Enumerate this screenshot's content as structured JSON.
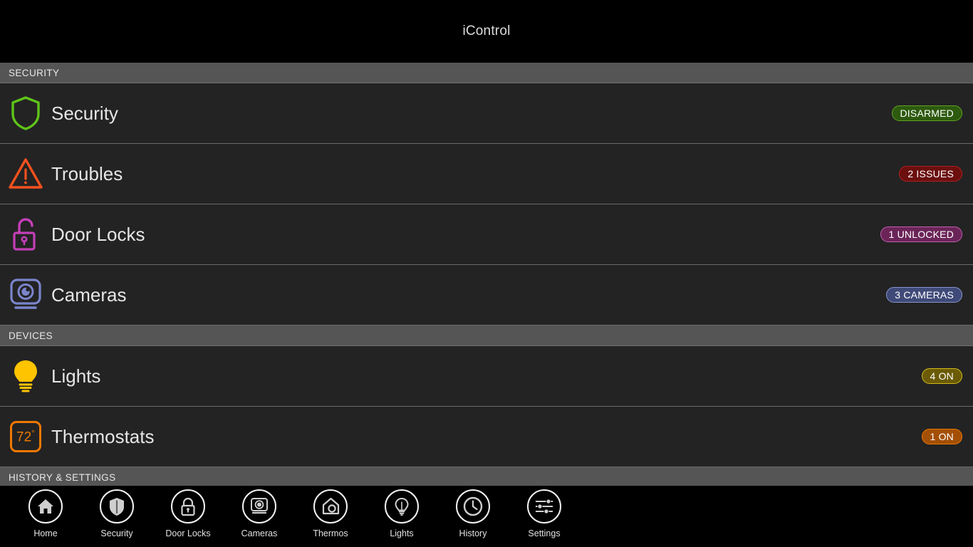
{
  "app": {
    "title": "iControl",
    "background": "#000000",
    "row_background": "#232323",
    "section_header_background": "#555555"
  },
  "sections": [
    {
      "id": "security",
      "header": "SECURITY",
      "rows": [
        {
          "id": "security",
          "label": "Security",
          "icon": "shield-icon",
          "icon_color": "#5fc419",
          "badge": {
            "text": "DISARMED",
            "fill": "#2d5a0f",
            "border": "#5fa320",
            "text_color": "#ffffff"
          }
        },
        {
          "id": "troubles",
          "label": "Troubles",
          "icon": "warning-triangle-icon",
          "icon_color": "#f4511e",
          "badge": {
            "text": "2 ISSUES",
            "fill": "#6b0f0f",
            "border": "#b32020",
            "text_color": "#ffffff"
          }
        },
        {
          "id": "door-locks",
          "label": "Door Locks",
          "icon": "unlocked-padlock-icon",
          "icon_color": "#c43fb8",
          "badge": {
            "text": "1 UNLOCKED",
            "fill": "#6b2458",
            "border": "#c060b0",
            "text_color": "#ffffff"
          }
        },
        {
          "id": "cameras",
          "label": "Cameras",
          "icon": "camera-icon",
          "icon_color": "#7a85cc",
          "badge": {
            "text": "3 CAMERAS",
            "fill": "#3f4a78",
            "border": "#8a94cc",
            "text_color": "#ffffff"
          }
        }
      ]
    },
    {
      "id": "devices",
      "header": "DEVICES",
      "rows": [
        {
          "id": "lights",
          "label": "Lights",
          "icon": "lightbulb-icon",
          "icon_color": "#ffc400",
          "badge": {
            "text": "4 ON",
            "fill": "#6b5b05",
            "border": "#d4bb1a",
            "text_color": "#ffffff"
          }
        },
        {
          "id": "thermostats",
          "label": "Thermostats",
          "icon": "thermostat-icon",
          "icon_color": "#f07800",
          "icon_text": "72",
          "icon_text_degree": "°",
          "badge": {
            "text": "1 ON",
            "fill": "#a34f05",
            "border": "#f07800",
            "text_color": "#ffffff"
          }
        }
      ]
    },
    {
      "id": "history-settings",
      "header": "HISTORY & SETTINGS",
      "rows": []
    }
  ],
  "navbar": {
    "items": [
      {
        "id": "home",
        "label": "Home",
        "icon": "home-icon"
      },
      {
        "id": "security",
        "label": "Security",
        "icon": "shield-icon"
      },
      {
        "id": "doorlocks",
        "label": "Door Locks",
        "icon": "padlock-icon"
      },
      {
        "id": "cameras",
        "label": "Cameras",
        "icon": "camera-icon"
      },
      {
        "id": "thermos",
        "label": "Thermos",
        "icon": "thermostat-house-icon"
      },
      {
        "id": "lights",
        "label": "Lights",
        "icon": "lightbulb-icon"
      },
      {
        "id": "history",
        "label": "History",
        "icon": "clock-icon"
      },
      {
        "id": "settings",
        "label": "Settings",
        "icon": "sliders-icon"
      }
    ]
  }
}
